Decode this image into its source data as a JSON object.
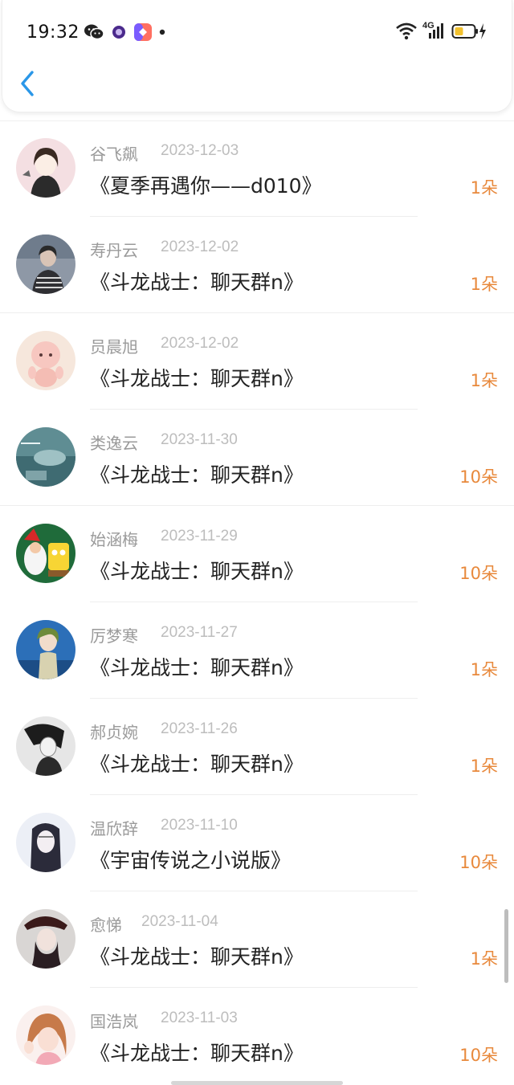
{
  "status_bar": {
    "time": "19:32",
    "network": "4G"
  },
  "nav": {
    "back_icon": "chevron-left-icon",
    "accent": "#2a97e8"
  },
  "colors": {
    "name": "#9a9a9a",
    "date": "#bdbdbd",
    "title": "#222222",
    "amount": "#e8893c"
  },
  "records": [
    {
      "name": "谷飞飙",
      "date": "2023-12-03",
      "title": "《夏季再遇你——d010》",
      "amount": "1朵"
    },
    {
      "name": "寿丹云",
      "date": "2023-12-02",
      "title": "《斗龙战士：聊天群n》",
      "amount": "1朵"
    },
    {
      "name": "员晨旭",
      "date": "2023-12-02",
      "title": "《斗龙战士：聊天群n》",
      "amount": "1朵"
    },
    {
      "name": "类逸云",
      "date": "2023-11-30",
      "title": "《斗龙战士：聊天群n》",
      "amount": "10朵"
    },
    {
      "name": "始涵梅",
      "date": "2023-11-29",
      "title": "《斗龙战士：聊天群n》",
      "amount": "10朵"
    },
    {
      "name": "厉梦寒",
      "date": "2023-11-27",
      "title": "《斗龙战士：聊天群n》",
      "amount": "1朵"
    },
    {
      "name": "郝贞婉",
      "date": "2023-11-26",
      "title": "《斗龙战士：聊天群n》",
      "amount": "1朵"
    },
    {
      "name": "温欣辞",
      "date": "2023-11-10",
      "title": "《宇宙传说之小说版》",
      "amount": "10朵"
    },
    {
      "name": "愈悌",
      "date": "2023-11-04",
      "title": "《斗龙战士：聊天群n》",
      "amount": "1朵"
    },
    {
      "name": "国浩岚",
      "date": "2023-11-03",
      "title": "《斗龙战士：聊天群n》",
      "amount": "10朵"
    }
  ]
}
